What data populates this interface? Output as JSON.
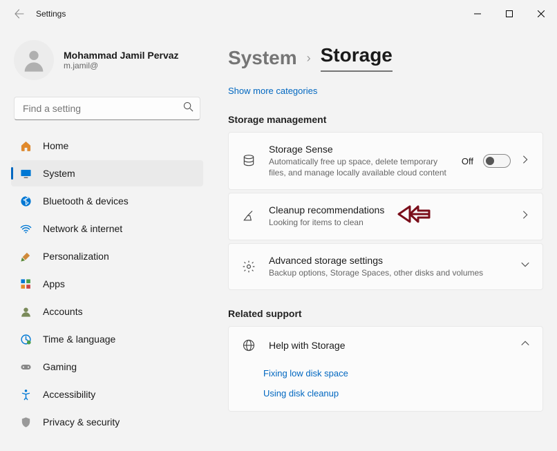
{
  "window": {
    "title": "Settings"
  },
  "user": {
    "name": "Mohammad Jamil Pervaz",
    "email": "m.jamil@"
  },
  "search": {
    "placeholder": "Find a setting"
  },
  "nav": {
    "home": "Home",
    "system": "System",
    "bluetooth": "Bluetooth & devices",
    "network": "Network & internet",
    "personalization": "Personalization",
    "apps": "Apps",
    "accounts": "Accounts",
    "time": "Time & language",
    "gaming": "Gaming",
    "accessibility": "Accessibility",
    "privacy": "Privacy & security"
  },
  "breadcrumb": {
    "parent": "System",
    "current": "Storage"
  },
  "showmore": "Show more categories",
  "sections": {
    "management": "Storage management",
    "related": "Related support"
  },
  "rows": {
    "sense": {
      "title": "Storage Sense",
      "sub": "Automatically free up space, delete temporary files, and manage locally available cloud content",
      "toggle": "Off"
    },
    "cleanup": {
      "title": "Cleanup recommendations",
      "sub": "Looking for items to clean"
    },
    "advanced": {
      "title": "Advanced storage settings",
      "sub": "Backup options, Storage Spaces, other disks and volumes"
    },
    "help": {
      "title": "Help with Storage",
      "links": {
        "low": "Fixing low disk space",
        "disk": "Using disk cleanup"
      }
    }
  }
}
